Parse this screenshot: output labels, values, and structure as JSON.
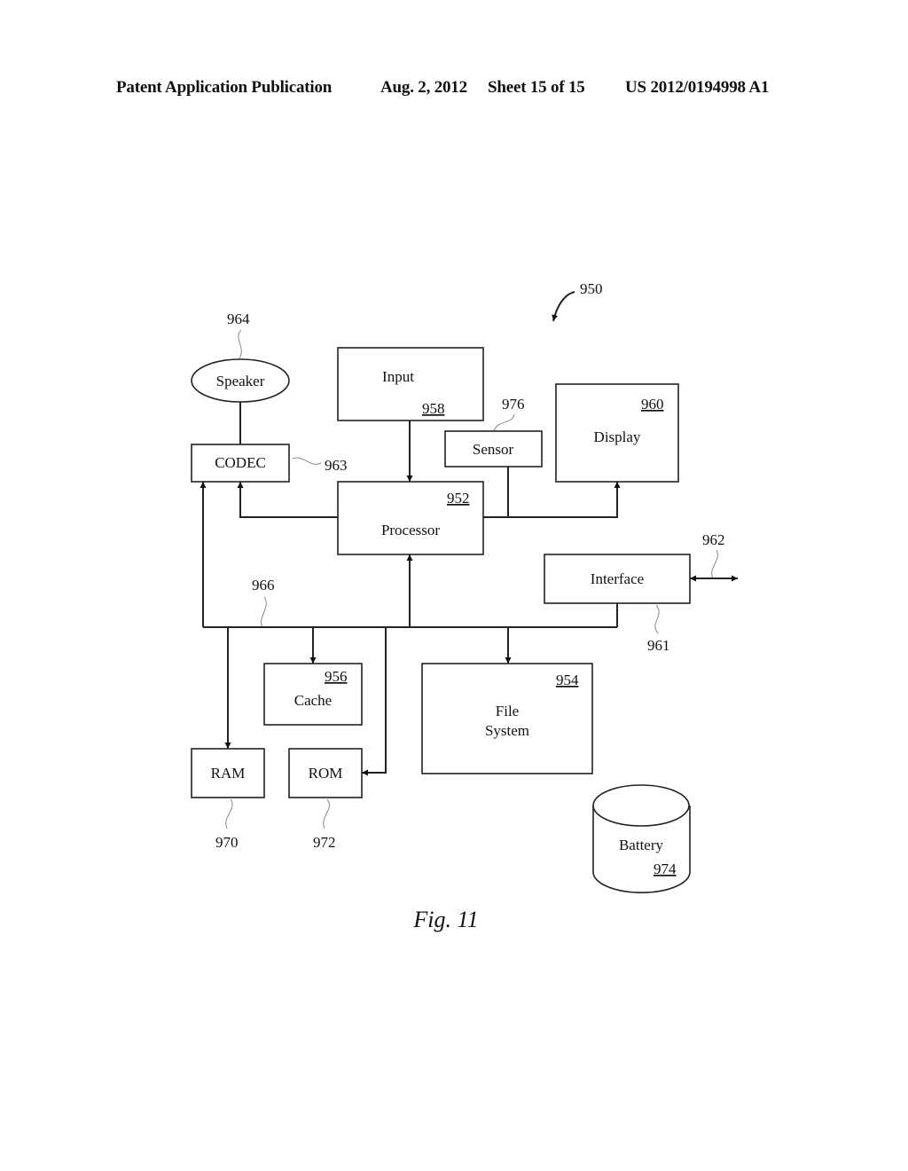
{
  "header": {
    "publication": "Patent Application Publication",
    "date": "Aug. 2, 2012",
    "sheet": "Sheet 15 of 15",
    "number": "US 2012/0194998 A1"
  },
  "figure": {
    "caption": "Fig. 11",
    "system_ref": "950",
    "components": {
      "speaker": {
        "label": "Speaker",
        "ref": "964"
      },
      "codec": {
        "label": "CODEC",
        "ref": "963"
      },
      "input": {
        "label": "Input",
        "ref": "958"
      },
      "sensor": {
        "label": "Sensor",
        "ref": "976"
      },
      "display": {
        "label": "Display",
        "ref": "960"
      },
      "processor": {
        "label": "Processor",
        "ref": "952"
      },
      "interface": {
        "label": "Interface",
        "ref": "961",
        "link_ref": "962"
      },
      "bus": {
        "ref": "966"
      },
      "cache": {
        "label": "Cache",
        "ref": "956"
      },
      "file_system": {
        "label_line1": "File",
        "label_line2": "System",
        "ref": "954"
      },
      "ram": {
        "label": "RAM",
        "ref": "970"
      },
      "rom": {
        "label": "ROM",
        "ref": "972"
      },
      "battery": {
        "label": "Battery",
        "ref": "974"
      }
    }
  }
}
